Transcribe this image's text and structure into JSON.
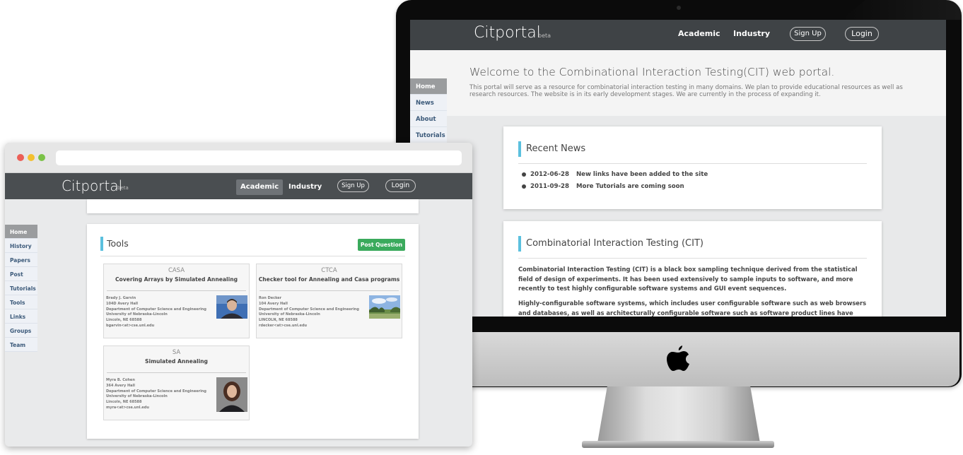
{
  "imac_screen": {
    "brand": "Citportal",
    "beta": "beta",
    "nav": {
      "academic": "Academic",
      "industry": "Industry",
      "signup": "Sign Up",
      "login": "Login"
    },
    "hero": {
      "title": "Welcome to the Combinational Interaction Testing(CIT) web portal.",
      "text": "This portal will serve as a resource for combinatorial interaction testing in many domains. We plan to provide educational resources as well as research resources. The website is in its early development stages. We are currently in the process of expanding it."
    },
    "sidebar": [
      "Home",
      "News",
      "About",
      "Tutorials"
    ],
    "recent_news": {
      "title": "Recent News",
      "items": [
        {
          "date": "2012-06-28",
          "text": "New links have been added to the site"
        },
        {
          "date": "2011-09-28",
          "text": "More Tutorials are coming soon"
        }
      ]
    },
    "cit": {
      "title": "Combinatorial Interaction Testing (CIT)",
      "para1": "Combinatorial Interaction Testing (CIT) is a black box sampling technique derived from the statistical field of design of experiments. It has been used extensively to sample inputs to software, and more recently to test highly configurable software systems and GUI event sequences.",
      "para2": "Highly-configurable software systems, which includes user configurable software such as web browsers and databases, as well as architecturally configurable software such as software product lines have very large"
    }
  },
  "browser": {
    "brand": "Citportal",
    "beta": "beta",
    "nav": {
      "academic": "Academic",
      "industry": "Industry",
      "signup": "Sign Up",
      "login": "Login"
    },
    "sidebar": [
      "Home",
      "History",
      "Papers",
      "Post",
      "Tutorials",
      "Tools",
      "Links",
      "Groups",
      "Team"
    ],
    "tools": {
      "title": "Tools",
      "post_button": "Post Question",
      "cards": [
        {
          "abbr": "CASA",
          "name": "Covering Arrays by Simulated Annealing",
          "info": [
            "Brady J. Garvin",
            "104D Avery Hall",
            "Department of Computer Science and Engineering",
            "University of Nebraska-Lincoln",
            "Lincoln, NE 68588",
            "bgarvin<at>cse.unl.edu"
          ]
        },
        {
          "abbr": "CTCA",
          "name": "Checker tool for Annealing and Casa programs",
          "info": [
            "Ron Decker",
            "104 Avery Hall",
            "Department of Computer Science and Engineering",
            "University of Nebraska-Lincoln",
            "LINCOLN, NE 68588",
            "rdecker<at>cse.unl.edu"
          ]
        },
        {
          "abbr": "SA",
          "name": "Simulated Annealing",
          "info": [
            "Myra B. Cohen",
            "364 Avery Hall",
            "Department of Computer Science and Engineering",
            "University of Nebraska-Lincoln",
            "Lincoln, NE 68588",
            "myra<at>cse.unl.edu"
          ]
        }
      ]
    }
  },
  "colors": {
    "nav_dark": "#3f4346",
    "accent_bar": "#5bc0de",
    "post_green": "#3aaa5c"
  }
}
